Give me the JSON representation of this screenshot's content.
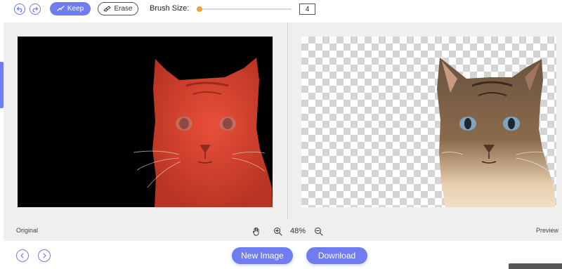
{
  "toolbar": {
    "undo_icon": "undo-icon",
    "redo_icon": "redo-icon",
    "keep_label": "Keep",
    "erase_label": "Erase",
    "brush_size_label": "Brush Size:",
    "brush_size_value": "4",
    "brush_slider_fraction": 0.0
  },
  "workspace": {
    "original_label": "Original",
    "preview_label": "Preview",
    "zoom_value": "48%"
  },
  "footer": {
    "new_image_label": "New Image",
    "download_label": "Download"
  },
  "colors": {
    "accent": "#6f7df0",
    "slider_knob": "#f4a13a",
    "mask_overlay": "#d9412b"
  }
}
